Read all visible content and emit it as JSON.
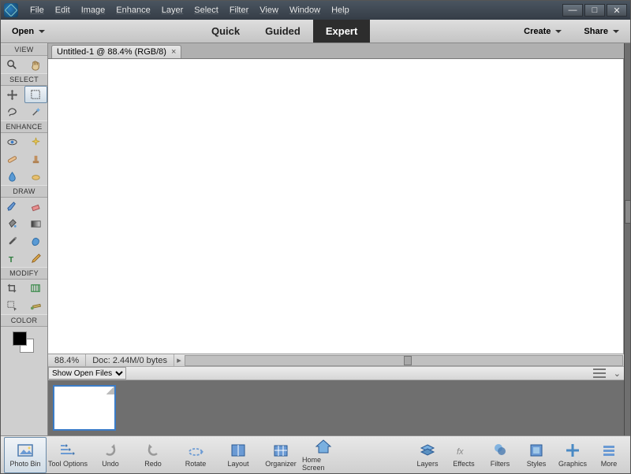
{
  "menu": [
    "File",
    "Edit",
    "Image",
    "Enhance",
    "Layer",
    "Select",
    "Filter",
    "View",
    "Window",
    "Help"
  ],
  "modebar": {
    "open": "Open",
    "tabs": [
      {
        "label": "Quick",
        "active": false
      },
      {
        "label": "Guided",
        "active": false
      },
      {
        "label": "Expert",
        "active": true
      }
    ],
    "create": "Create",
    "share": "Share"
  },
  "toolpanel": {
    "sections": [
      {
        "title": "VIEW",
        "tools": [
          {
            "name": "zoom-tool",
            "icon": "zoom"
          },
          {
            "name": "hand-tool",
            "icon": "hand"
          }
        ]
      },
      {
        "title": "SELECT",
        "tools": [
          {
            "name": "move-tool",
            "icon": "move"
          },
          {
            "name": "marquee-tool",
            "icon": "marquee",
            "selected": true
          },
          {
            "name": "lasso-tool",
            "icon": "lasso"
          },
          {
            "name": "magic-wand-tool",
            "icon": "wand"
          }
        ]
      },
      {
        "title": "ENHANCE",
        "tools": [
          {
            "name": "eye-tool",
            "icon": "eye"
          },
          {
            "name": "whiten-tool",
            "icon": "sparkle"
          },
          {
            "name": "spot-heal-tool",
            "icon": "bandage"
          },
          {
            "name": "clone-stamp-tool",
            "icon": "stamp"
          },
          {
            "name": "blur-tool",
            "icon": "drop"
          },
          {
            "name": "sponge-tool",
            "icon": "sponge"
          }
        ]
      },
      {
        "title": "DRAW",
        "tools": [
          {
            "name": "brush-tool",
            "icon": "brush"
          },
          {
            "name": "eraser-tool",
            "icon": "eraser"
          },
          {
            "name": "fill-tool",
            "icon": "bucket"
          },
          {
            "name": "gradient-tool",
            "icon": "gradient"
          },
          {
            "name": "eyedropper-tool",
            "icon": "dropper"
          },
          {
            "name": "shape-tool",
            "icon": "blob"
          },
          {
            "name": "type-tool",
            "icon": "type"
          },
          {
            "name": "pencil-tool",
            "icon": "pencil"
          }
        ]
      },
      {
        "title": "MODIFY",
        "tools": [
          {
            "name": "crop-tool",
            "icon": "crop"
          },
          {
            "name": "recompose-tool",
            "icon": "recompose"
          },
          {
            "name": "content-move-tool",
            "icon": "movesel"
          },
          {
            "name": "straighten-tool",
            "icon": "straighten"
          }
        ]
      },
      {
        "title": "COLOR",
        "tools": []
      }
    ]
  },
  "document": {
    "tab_label": "Untitled-1 @ 88.4% (RGB/8)",
    "zoom": "88.4%",
    "doc_info": "Doc: 2.44M/0 bytes",
    "bin_dropdown": "Show Open Files"
  },
  "bottom": {
    "left": [
      {
        "name": "photo-bin",
        "label": "Photo Bin",
        "icon": "photo",
        "selected": true
      },
      {
        "name": "tool-options",
        "label": "Tool Options",
        "icon": "options"
      },
      {
        "name": "undo",
        "label": "Undo",
        "icon": "undo"
      },
      {
        "name": "redo",
        "label": "Redo",
        "icon": "redo"
      },
      {
        "name": "rotate",
        "label": "Rotate",
        "icon": "rotate"
      },
      {
        "name": "layout",
        "label": "Layout",
        "icon": "layout"
      },
      {
        "name": "organizer",
        "label": "Organizer",
        "icon": "organizer"
      },
      {
        "name": "home-screen",
        "label": "Home Screen",
        "icon": "home"
      }
    ],
    "right": [
      {
        "name": "layers",
        "label": "Layers",
        "icon": "layers"
      },
      {
        "name": "effects",
        "label": "Effects",
        "icon": "fx"
      },
      {
        "name": "filters",
        "label": "Filters",
        "icon": "filters"
      },
      {
        "name": "styles",
        "label": "Styles",
        "icon": "styles"
      },
      {
        "name": "graphics",
        "label": "Graphics",
        "icon": "graphics"
      },
      {
        "name": "more",
        "label": "More",
        "icon": "more"
      }
    ]
  },
  "colors": {
    "accent": "#3b7cc7"
  }
}
